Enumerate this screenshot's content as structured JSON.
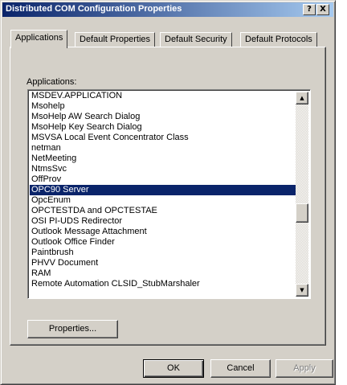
{
  "window": {
    "title": "Distributed COM Configuration Properties",
    "help_glyph": "?",
    "close_glyph": "X"
  },
  "tabs": [
    {
      "label": "Applications",
      "active": true
    },
    {
      "label": "Default Properties",
      "active": false
    },
    {
      "label": "Default Security",
      "active": false
    },
    {
      "label": "Default Protocols",
      "active": false
    }
  ],
  "applications": {
    "label": "Applications:",
    "selected_index": 9,
    "items": [
      "MSDEV.APPLICATION",
      "Msohelp",
      "MsoHelp AW Search Dialog",
      "MsoHelp Key Search Dialog",
      "MSVSA Local Event Concentrator Class",
      "netman",
      "NetMeeting",
      "NtmsSvc",
      "OffProv",
      "OPC90 Server",
      "OpcEnum",
      "OPCTESTDA and OPCTESTAE",
      "OSI PI-UDS Redirector",
      "Outlook Message Attachment",
      "Outlook Office Finder",
      "Paintbrush",
      "PHVV Document",
      "RAM",
      "Remote Automation CLSID_StubMarshaler"
    ],
    "scroll_position": 0.62
  },
  "buttons": {
    "properties": "Properties...",
    "ok": "OK",
    "cancel": "Cancel",
    "apply": "Apply"
  },
  "icons": {
    "scroll_up": "scroll-up-arrow-icon",
    "scroll_down": "scroll-down-arrow-icon"
  },
  "colors": {
    "title_start": "#0a246a",
    "title_end": "#a6caf0",
    "selection": "#0a246a",
    "face": "#d4d0c8"
  }
}
